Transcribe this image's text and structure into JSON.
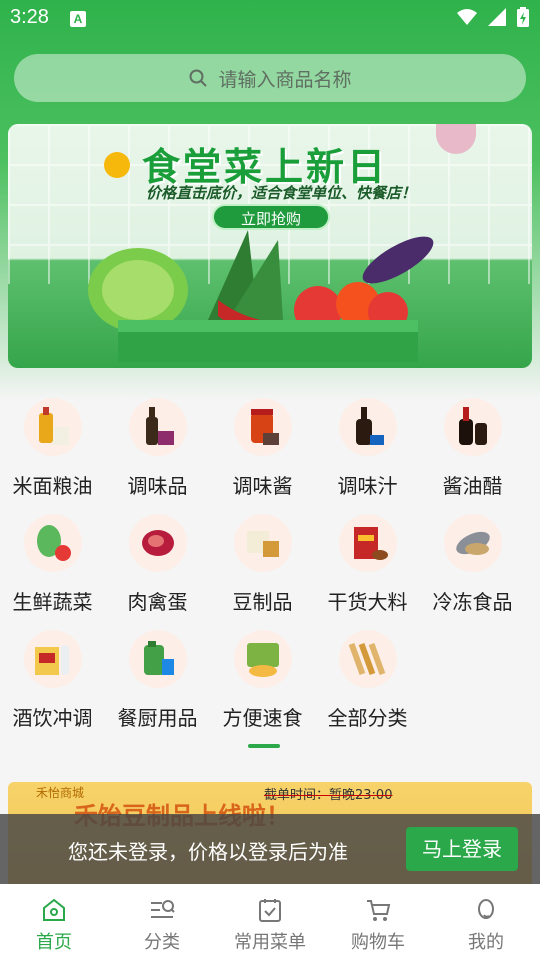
{
  "status_bar": {
    "time": "3:28",
    "notif_icon": "A"
  },
  "search": {
    "placeholder": "请输入商品名称",
    "icon": "search-icon"
  },
  "banner": {
    "title": "食堂菜上新日",
    "subtitle": "价格直击底价，适合食堂单位、快餐店！",
    "button": "立即抢购"
  },
  "categories": [
    {
      "label": "米面粮油",
      "icon": "oil-rice-icon"
    },
    {
      "label": "调味品",
      "icon": "seasoning-icon"
    },
    {
      "label": "调味酱",
      "icon": "sauce-icon"
    },
    {
      "label": "调味汁",
      "icon": "juice-sauce-icon"
    },
    {
      "label": "酱油醋",
      "icon": "soy-vinegar-icon"
    },
    {
      "label": "生鲜蔬菜",
      "icon": "vegetable-icon"
    },
    {
      "label": "肉禽蛋",
      "icon": "meat-icon"
    },
    {
      "label": "豆制品",
      "icon": "tofu-icon"
    },
    {
      "label": "干货大料",
      "icon": "dry-goods-icon"
    },
    {
      "label": "冷冻食品",
      "icon": "frozen-food-icon"
    },
    {
      "label": "酒饮冲调",
      "icon": "drinks-icon"
    },
    {
      "label": "餐厨用品",
      "icon": "kitchen-supplies-icon"
    },
    {
      "label": "方便速食",
      "icon": "instant-food-icon"
    },
    {
      "label": "全部分类",
      "icon": "all-categories-icon"
    }
  ],
  "promo": {
    "brand": "禾怡商城",
    "title": "禾饴豆制品上线啦！",
    "time": "截单时间：暂晚23:00"
  },
  "login_prompt": {
    "text": "您还未登录，价格以登录后为准",
    "button": "马上登录"
  },
  "tabbar": [
    {
      "label": "首页",
      "icon": "home-icon",
      "active": true
    },
    {
      "label": "分类",
      "icon": "category-icon",
      "active": false
    },
    {
      "label": "常用菜单",
      "icon": "menu-list-icon",
      "active": false
    },
    {
      "label": "购物车",
      "icon": "cart-icon",
      "active": false
    },
    {
      "label": "我的",
      "icon": "profile-icon",
      "active": false
    }
  ],
  "colors": {
    "brand": "#2aa84a",
    "header_top": "#2fb24b"
  }
}
